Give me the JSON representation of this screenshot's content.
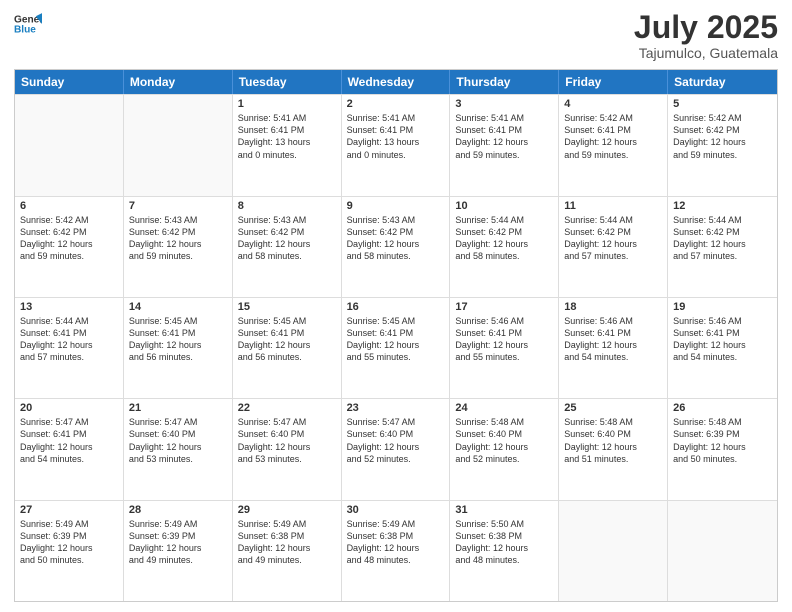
{
  "logo": {
    "line1": "General",
    "line2": "Blue"
  },
  "title": "July 2025",
  "location": "Tajumulco, Guatemala",
  "header_days": [
    "Sunday",
    "Monday",
    "Tuesday",
    "Wednesday",
    "Thursday",
    "Friday",
    "Saturday"
  ],
  "weeks": [
    [
      {
        "day": "",
        "info": ""
      },
      {
        "day": "",
        "info": ""
      },
      {
        "day": "1",
        "info": "Sunrise: 5:41 AM\nSunset: 6:41 PM\nDaylight: 13 hours\nand 0 minutes."
      },
      {
        "day": "2",
        "info": "Sunrise: 5:41 AM\nSunset: 6:41 PM\nDaylight: 13 hours\nand 0 minutes."
      },
      {
        "day": "3",
        "info": "Sunrise: 5:41 AM\nSunset: 6:41 PM\nDaylight: 12 hours\nand 59 minutes."
      },
      {
        "day": "4",
        "info": "Sunrise: 5:42 AM\nSunset: 6:41 PM\nDaylight: 12 hours\nand 59 minutes."
      },
      {
        "day": "5",
        "info": "Sunrise: 5:42 AM\nSunset: 6:42 PM\nDaylight: 12 hours\nand 59 minutes."
      }
    ],
    [
      {
        "day": "6",
        "info": "Sunrise: 5:42 AM\nSunset: 6:42 PM\nDaylight: 12 hours\nand 59 minutes."
      },
      {
        "day": "7",
        "info": "Sunrise: 5:43 AM\nSunset: 6:42 PM\nDaylight: 12 hours\nand 59 minutes."
      },
      {
        "day": "8",
        "info": "Sunrise: 5:43 AM\nSunset: 6:42 PM\nDaylight: 12 hours\nand 58 minutes."
      },
      {
        "day": "9",
        "info": "Sunrise: 5:43 AM\nSunset: 6:42 PM\nDaylight: 12 hours\nand 58 minutes."
      },
      {
        "day": "10",
        "info": "Sunrise: 5:44 AM\nSunset: 6:42 PM\nDaylight: 12 hours\nand 58 minutes."
      },
      {
        "day": "11",
        "info": "Sunrise: 5:44 AM\nSunset: 6:42 PM\nDaylight: 12 hours\nand 57 minutes."
      },
      {
        "day": "12",
        "info": "Sunrise: 5:44 AM\nSunset: 6:42 PM\nDaylight: 12 hours\nand 57 minutes."
      }
    ],
    [
      {
        "day": "13",
        "info": "Sunrise: 5:44 AM\nSunset: 6:41 PM\nDaylight: 12 hours\nand 57 minutes."
      },
      {
        "day": "14",
        "info": "Sunrise: 5:45 AM\nSunset: 6:41 PM\nDaylight: 12 hours\nand 56 minutes."
      },
      {
        "day": "15",
        "info": "Sunrise: 5:45 AM\nSunset: 6:41 PM\nDaylight: 12 hours\nand 56 minutes."
      },
      {
        "day": "16",
        "info": "Sunrise: 5:45 AM\nSunset: 6:41 PM\nDaylight: 12 hours\nand 55 minutes."
      },
      {
        "day": "17",
        "info": "Sunrise: 5:46 AM\nSunset: 6:41 PM\nDaylight: 12 hours\nand 55 minutes."
      },
      {
        "day": "18",
        "info": "Sunrise: 5:46 AM\nSunset: 6:41 PM\nDaylight: 12 hours\nand 54 minutes."
      },
      {
        "day": "19",
        "info": "Sunrise: 5:46 AM\nSunset: 6:41 PM\nDaylight: 12 hours\nand 54 minutes."
      }
    ],
    [
      {
        "day": "20",
        "info": "Sunrise: 5:47 AM\nSunset: 6:41 PM\nDaylight: 12 hours\nand 54 minutes."
      },
      {
        "day": "21",
        "info": "Sunrise: 5:47 AM\nSunset: 6:40 PM\nDaylight: 12 hours\nand 53 minutes."
      },
      {
        "day": "22",
        "info": "Sunrise: 5:47 AM\nSunset: 6:40 PM\nDaylight: 12 hours\nand 53 minutes."
      },
      {
        "day": "23",
        "info": "Sunrise: 5:47 AM\nSunset: 6:40 PM\nDaylight: 12 hours\nand 52 minutes."
      },
      {
        "day": "24",
        "info": "Sunrise: 5:48 AM\nSunset: 6:40 PM\nDaylight: 12 hours\nand 52 minutes."
      },
      {
        "day": "25",
        "info": "Sunrise: 5:48 AM\nSunset: 6:40 PM\nDaylight: 12 hours\nand 51 minutes."
      },
      {
        "day": "26",
        "info": "Sunrise: 5:48 AM\nSunset: 6:39 PM\nDaylight: 12 hours\nand 50 minutes."
      }
    ],
    [
      {
        "day": "27",
        "info": "Sunrise: 5:49 AM\nSunset: 6:39 PM\nDaylight: 12 hours\nand 50 minutes."
      },
      {
        "day": "28",
        "info": "Sunrise: 5:49 AM\nSunset: 6:39 PM\nDaylight: 12 hours\nand 49 minutes."
      },
      {
        "day": "29",
        "info": "Sunrise: 5:49 AM\nSunset: 6:38 PM\nDaylight: 12 hours\nand 49 minutes."
      },
      {
        "day": "30",
        "info": "Sunrise: 5:49 AM\nSunset: 6:38 PM\nDaylight: 12 hours\nand 48 minutes."
      },
      {
        "day": "31",
        "info": "Sunrise: 5:50 AM\nSunset: 6:38 PM\nDaylight: 12 hours\nand 48 minutes."
      },
      {
        "day": "",
        "info": ""
      },
      {
        "day": "",
        "info": ""
      }
    ]
  ]
}
